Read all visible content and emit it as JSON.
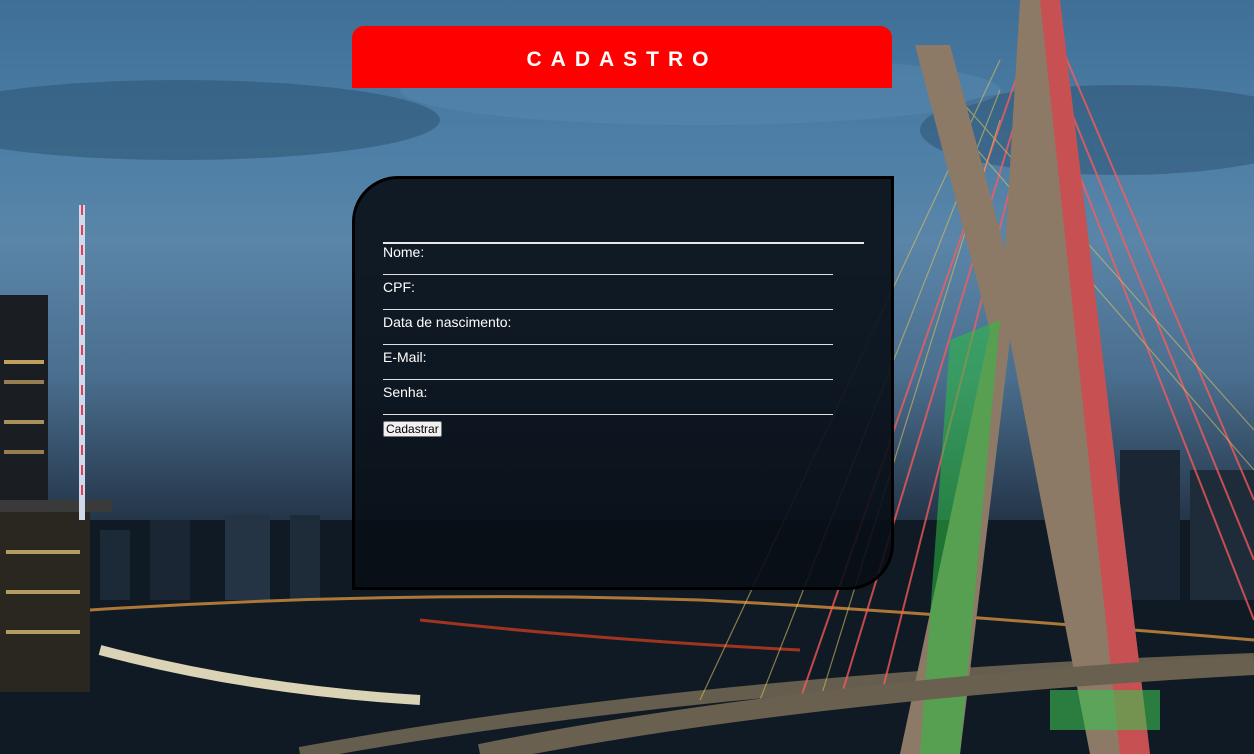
{
  "header": {
    "title": "CADASTRO"
  },
  "form": {
    "fields": [
      {
        "label": "Nome:",
        "value": ""
      },
      {
        "label": "CPF:",
        "value": ""
      },
      {
        "label": "Data de nascimento:",
        "value": ""
      },
      {
        "label": "E-Mail:",
        "value": ""
      },
      {
        "label": "Senha:",
        "value": ""
      }
    ],
    "submit_label": "Cadastrar"
  },
  "colors": {
    "header_background": "#ff0000",
    "panel_background": "#0b121b",
    "text": "#ffffff"
  }
}
